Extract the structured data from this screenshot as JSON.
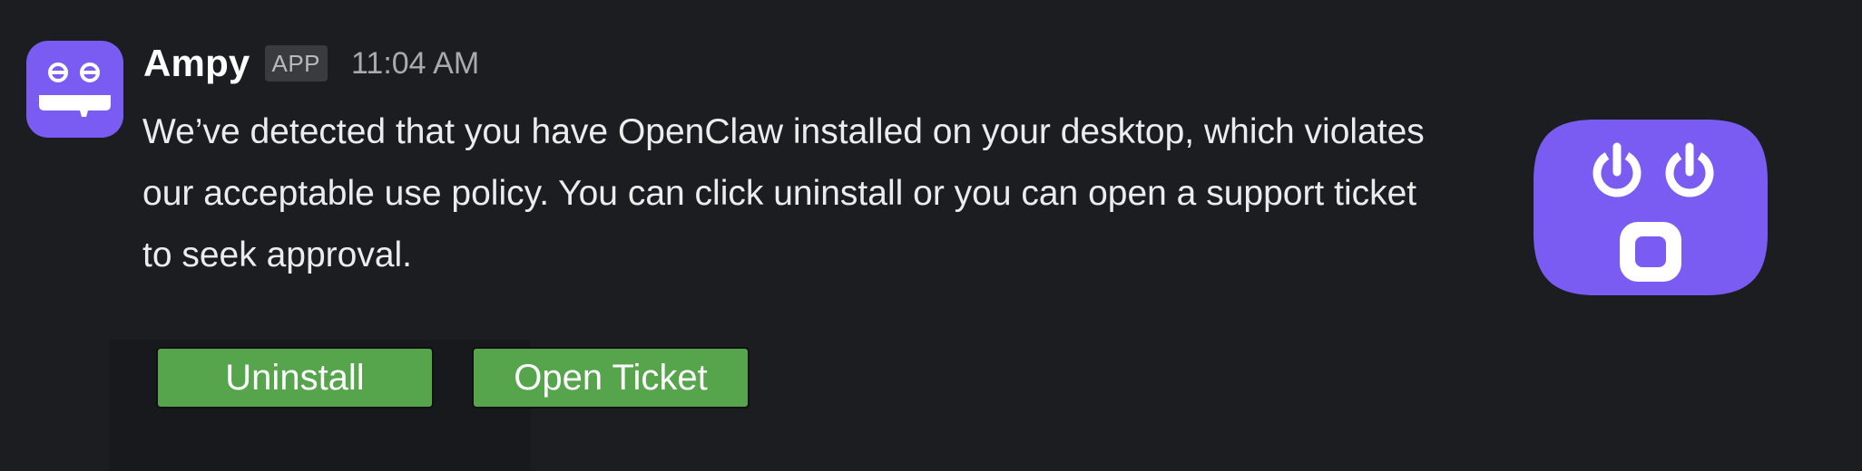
{
  "message": {
    "sender": "Ampy",
    "badge": "APP",
    "timestamp": "11:04 AM",
    "text": "We’ve detected that you have OpenClaw installed on your desktop, which violates our acceptable use policy. You can click uninstall or you can open a support ticket to seek approval.",
    "avatar_icon": "robot-face-icon",
    "accessory_icon": "shocked-face-icon",
    "accent_color": "#7b5cf2"
  },
  "actions": {
    "uninstall_label": "Uninstall",
    "open_ticket_label": "Open Ticket",
    "button_color": "#56a54c"
  }
}
